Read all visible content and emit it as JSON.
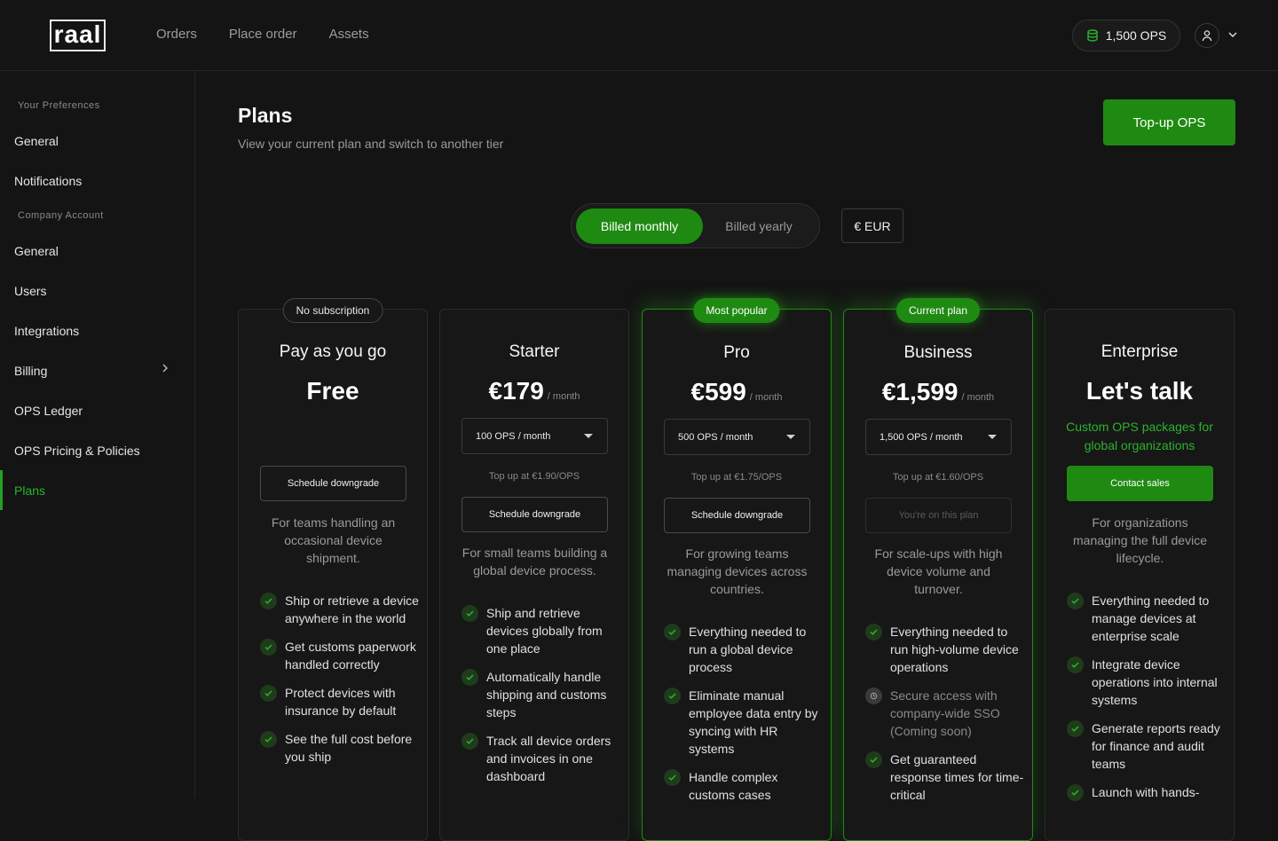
{
  "brand": {
    "logo_text": "raal"
  },
  "nav": {
    "items": [
      "Orders",
      "Place order",
      "Assets"
    ]
  },
  "header": {
    "ops_balance": "1,500 OPS",
    "coin_icon": "coin-stack-icon",
    "avatar_icon": "user-icon",
    "accent": "#1f8a12"
  },
  "sidebar": {
    "section_preferences": "Your Preferences",
    "section_company": "Company Account",
    "items": [
      "General",
      "Notifications",
      "General",
      "Users",
      "Integrations",
      "Billing",
      "OPS Ledger",
      "OPS Pricing & Policies",
      "Plans"
    ],
    "active": "Plans"
  },
  "page": {
    "title": "Plans",
    "subtitle": "View your current plan and switch to another tier",
    "topup_label": "Top-up OPS",
    "billing": {
      "monthly": "Billed monthly",
      "yearly": "Billed yearly",
      "selected": "monthly"
    },
    "currency": "€ EUR"
  },
  "plans": [
    {
      "badge": "No subscription",
      "name": "Pay as you go",
      "price": "Free",
      "per": "",
      "button": "Schedule downgrade",
      "description": "For teams handling an occasional device shipment.",
      "features": [
        "Ship or retrieve a device anywhere in the world",
        "Get customs paperwork handled correctly",
        "Protect devices with insurance by default",
        "See the full cost before you ship"
      ]
    },
    {
      "badge": "",
      "name": "Starter",
      "price": "€179",
      "per": "/ month",
      "select": "100 OPS / month",
      "topup_note": "Top up at €1.90/OPS",
      "button": "Schedule downgrade",
      "description": "For small teams building a global device process.",
      "features": [
        "Ship and retrieve devices globally from one place",
        "Automatically handle shipping and customs steps",
        "Track all device orders and invoices in one dashboard"
      ]
    },
    {
      "badge": "Most popular",
      "name": "Pro",
      "price": "€599",
      "per": "/ month",
      "select": "500 OPS / month",
      "topup_note": "Top up at €1.75/OPS",
      "button": "Schedule downgrade",
      "description": "For growing teams managing devices across countries.",
      "features": [
        "Everything needed to run a global device process",
        "Eliminate manual employee data entry by syncing with HR systems",
        "Handle complex customs cases"
      ]
    },
    {
      "badge": "Current plan",
      "name": "Business",
      "price": "€1,599",
      "per": "/ month",
      "select": "1,500 OPS / month",
      "topup_note": "Top up at €1.60/OPS",
      "button": "You're on this plan",
      "description": "For scale-ups with high device volume and turnover.",
      "features": [
        "Everything needed to run high-volume device operations",
        "Secure access with company-wide SSO (Coming soon)",
        "Get guaranteed response times for time-critical"
      ]
    },
    {
      "badge": "",
      "name": "Enterprise",
      "price": "Let's talk",
      "per": "",
      "tagline": "Custom OPS packages for global organizations",
      "button": "Contact sales",
      "description": "For organizations managing the full device lifecycle.",
      "features": [
        "Everything needed to manage devices at enterprise scale",
        "Integrate device operations into internal systems",
        "Generate reports ready for finance and audit teams",
        "Launch with hands-"
      ]
    }
  ]
}
